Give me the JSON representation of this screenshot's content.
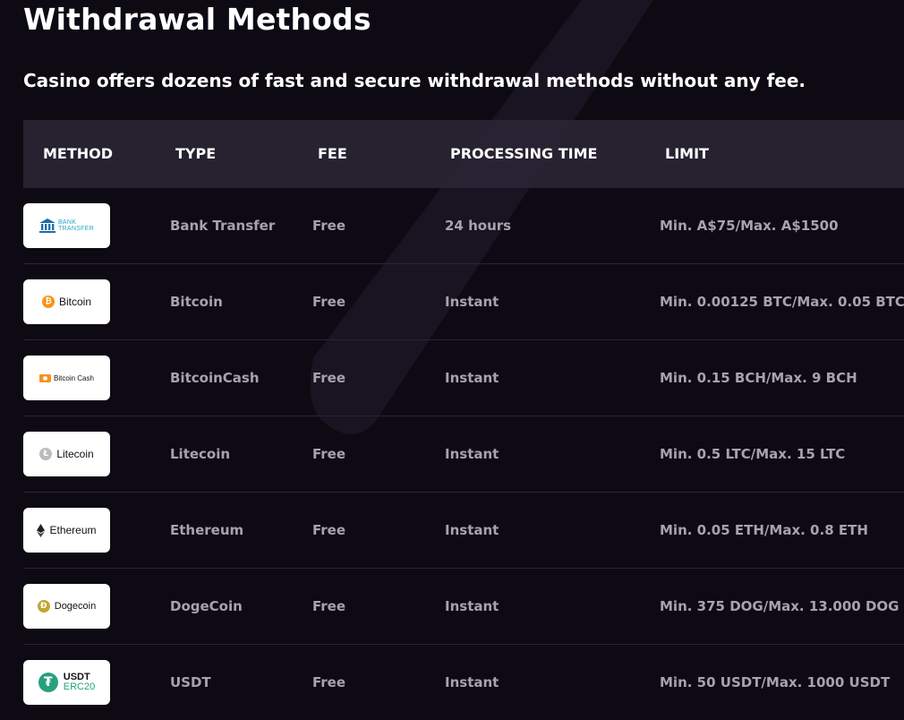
{
  "page": {
    "title": "Withdrawal Methods",
    "subtitle": "Casino offers dozens of fast and secure withdrawal methods without any fee."
  },
  "table": {
    "headers": {
      "method": "METHOD",
      "type": "TYPE",
      "fee": "FEE",
      "processing_time": "PROCESSING TIME",
      "limit": "LIMIT"
    },
    "rows": [
      {
        "logo_text": "BANK",
        "logo_text2": "TRANSFER",
        "type": "Bank Transfer",
        "fee": "Free",
        "processing_time": "24 hours",
        "limit": "Min. A$75/Max. A$1500"
      },
      {
        "logo_text": "Bitcoin",
        "type": "Bitcoin",
        "fee": "Free",
        "processing_time": "Instant",
        "limit": "Min. 0.00125 BTC/Max. 0.05 BTC"
      },
      {
        "logo_text": "Bitcoin Cash",
        "type": "BitcoinCash",
        "fee": "Free",
        "processing_time": "Instant",
        "limit": "Min. 0.15 BCH/Max. 9 BCH"
      },
      {
        "logo_text": "Litecoin",
        "type": "Litecoin",
        "fee": "Free",
        "processing_time": "Instant",
        "limit": "Min. 0.5 LTC/Max. 15 LTC"
      },
      {
        "logo_text": "Ethereum",
        "type": "Ethereum",
        "fee": "Free",
        "processing_time": "Instant",
        "limit": "Min. 0.05 ETH/Max. 0.8 ETH"
      },
      {
        "logo_text": "Dogecoin",
        "type": "DogeCoin",
        "fee": "Free",
        "processing_time": "Instant",
        "limit": "Min. 375 DOG/Max. 13.000 DOG"
      },
      {
        "logo_text": "USDT",
        "logo_text2": "ERC20",
        "type": "USDT",
        "fee": "Free",
        "processing_time": "Instant",
        "limit": "Min. 50 USDT/Max. 1000 USDT"
      }
    ]
  },
  "icons": {
    "bank": "bank-icon",
    "bitcoin": "bitcoin-icon",
    "bitcoin_cash": "bitcoin-cash-icon",
    "litecoin": "litecoin-icon",
    "ethereum": "ethereum-icon",
    "dogecoin": "dogecoin-icon",
    "usdt": "tether-icon"
  },
  "colors": {
    "background": "#0d0a14",
    "header_bg": "#2a2534",
    "row_text": "#a7a3ad",
    "bitcoin": "#f7931a",
    "litecoin": "#bfbbbb",
    "dogecoin": "#c2a633",
    "tether": "#26a17b",
    "bank": "#2aa4c8"
  }
}
